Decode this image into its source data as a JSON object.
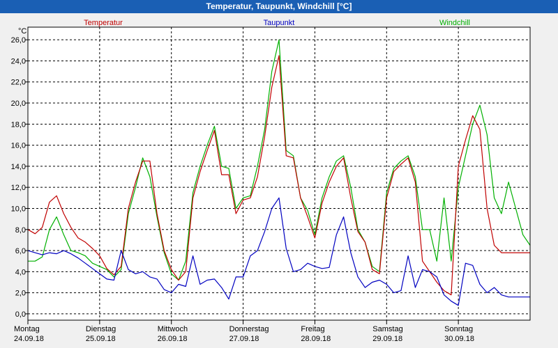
{
  "window": {
    "title": "Temperatur, Taupunkt, Windchill [°C]"
  },
  "chart_data": {
    "type": "line",
    "title": "Temperatur, Taupunkt, Windchill [°C]",
    "ylabel": "°C",
    "ylim": [
      -0.6,
      27.2
    ],
    "yticks": [
      0,
      2,
      4,
      6,
      8,
      10,
      12,
      14,
      16,
      18,
      20,
      22,
      24,
      26
    ],
    "ytick_labels": [
      "0,0",
      "2,0",
      "4,0",
      "6,0",
      "8,0",
      "10,0",
      "12,0",
      "14,0",
      "16,0",
      "18,0",
      "20,0",
      "22,0",
      "24,0",
      "26,0"
    ],
    "xlim": [
      0,
      7
    ],
    "grid": true,
    "legend_position": "top",
    "x_labels": [
      {
        "day": "Montag",
        "date": "24.09.18"
      },
      {
        "day": "Dienstag",
        "date": "25.09.18"
      },
      {
        "day": "Mittwoch",
        "date": "26.09.18"
      },
      {
        "day": "Donnerstag",
        "date": "27.09.18"
      },
      {
        "day": "Freitag",
        "date": "28.09.18"
      },
      {
        "day": "Samstag",
        "date": "29.09.18"
      },
      {
        "day": "Sonntag",
        "date": "30.09.18"
      }
    ],
    "series": [
      {
        "name": "Temperatur",
        "color": "#c00000",
        "x": [
          0,
          0.1,
          0.2,
          0.3,
          0.4,
          0.5,
          0.6,
          0.7,
          0.8,
          0.9,
          1.0,
          1.1,
          1.2,
          1.3,
          1.4,
          1.5,
          1.6,
          1.7,
          1.8,
          1.9,
          2.0,
          2.1,
          2.2,
          2.3,
          2.4,
          2.5,
          2.6,
          2.7,
          2.8,
          2.9,
          3.0,
          3.1,
          3.2,
          3.3,
          3.4,
          3.5,
          3.6,
          3.7,
          3.8,
          3.9,
          4.0,
          4.1,
          4.2,
          4.3,
          4.4,
          4.5,
          4.6,
          4.7,
          4.8,
          4.9,
          5.0,
          5.1,
          5.2,
          5.3,
          5.4,
          5.5,
          5.6,
          5.7,
          5.8,
          5.9,
          6.0,
          6.1,
          6.2,
          6.3,
          6.4,
          6.5,
          6.6,
          6.7,
          6.8,
          6.9,
          7.0
        ],
        "y": [
          8,
          7.6,
          8.2,
          10.6,
          11.2,
          9.5,
          8.2,
          7.2,
          6.8,
          6.2,
          5.5,
          4.3,
          3.7,
          4.5,
          10,
          12.5,
          14.5,
          14.5,
          9.5,
          6,
          4.2,
          3.2,
          4,
          11,
          13.5,
          15.5,
          17.4,
          13.2,
          13.2,
          9.5,
          10.8,
          11,
          13,
          16.8,
          21.5,
          24.5,
          15,
          14.8,
          11,
          9.2,
          7.2,
          10.5,
          12.5,
          14,
          14.8,
          11,
          7.8,
          6.8,
          4.2,
          3.8,
          11,
          13.5,
          14.2,
          14.8,
          12.5,
          5,
          4,
          3,
          2.2,
          1.8,
          14,
          16.5,
          18.8,
          17.5,
          10,
          6.5,
          5.8,
          5.8,
          5.8,
          5.8,
          5.8
        ]
      },
      {
        "name": "Taupunkt",
        "color": "#0000c0",
        "x": [
          0,
          0.1,
          0.2,
          0.3,
          0.4,
          0.5,
          0.6,
          0.7,
          0.8,
          0.9,
          1.0,
          1.1,
          1.2,
          1.3,
          1.4,
          1.5,
          1.6,
          1.7,
          1.8,
          1.9,
          2.0,
          2.1,
          2.2,
          2.3,
          2.4,
          2.5,
          2.6,
          2.7,
          2.8,
          2.9,
          3.0,
          3.1,
          3.2,
          3.3,
          3.4,
          3.5,
          3.6,
          3.7,
          3.8,
          3.9,
          4.0,
          4.1,
          4.2,
          4.3,
          4.4,
          4.5,
          4.6,
          4.7,
          4.8,
          4.9,
          5.0,
          5.1,
          5.2,
          5.3,
          5.4,
          5.5,
          5.6,
          5.7,
          5.8,
          5.9,
          6.0,
          6.1,
          6.2,
          6.3,
          6.4,
          6.5,
          6.6,
          6.7,
          6.8,
          6.9,
          7.0
        ],
        "y": [
          6,
          5.8,
          5.6,
          5.8,
          5.7,
          6,
          5.7,
          5.3,
          4.8,
          4.3,
          3.8,
          3.3,
          3.2,
          6,
          4.2,
          3.8,
          4,
          3.5,
          3.3,
          2.3,
          2,
          2.8,
          2.6,
          5.5,
          2.8,
          3.2,
          3.3,
          2.5,
          1.4,
          3.5,
          3.5,
          5.5,
          6,
          7.8,
          10,
          11,
          6.2,
          4,
          4.2,
          4.8,
          4.5,
          4.3,
          4.4,
          7.5,
          9.2,
          5.8,
          3.5,
          2.5,
          3,
          3.2,
          2.8,
          2,
          2.2,
          5.5,
          2.5,
          4.2,
          4,
          3.5,
          1.8,
          1.2,
          0.8,
          4.8,
          4.6,
          2.8,
          2,
          2.5,
          1.8,
          1.6,
          1.6,
          1.6,
          1.6
        ]
      },
      {
        "name": "Windchill",
        "color": "#00b000",
        "x": [
          0,
          0.1,
          0.2,
          0.3,
          0.4,
          0.5,
          0.6,
          0.7,
          0.8,
          0.9,
          1.0,
          1.1,
          1.2,
          1.3,
          1.4,
          1.5,
          1.6,
          1.7,
          1.8,
          1.9,
          2.0,
          2.1,
          2.2,
          2.3,
          2.4,
          2.5,
          2.6,
          2.7,
          2.8,
          2.9,
          3.0,
          3.1,
          3.2,
          3.3,
          3.4,
          3.5,
          3.6,
          3.7,
          3.8,
          3.9,
          4.0,
          4.1,
          4.2,
          4.3,
          4.4,
          4.5,
          4.6,
          4.7,
          4.8,
          4.9,
          5.0,
          5.1,
          5.2,
          5.3,
          5.4,
          5.5,
          5.6,
          5.7,
          5.8,
          5.9,
          6.0,
          6.1,
          6.2,
          6.3,
          6.4,
          6.5,
          6.6,
          6.7,
          6.8,
          6.9,
          7.0
        ],
        "y": [
          5,
          5,
          5.4,
          8,
          9.2,
          7.5,
          6,
          5.8,
          5.5,
          4.8,
          4.5,
          4.2,
          3.5,
          4.2,
          9.5,
          12,
          14.8,
          13,
          9.2,
          5.8,
          3.8,
          3.2,
          5,
          11.5,
          14,
          16,
          17.8,
          14,
          13.8,
          10,
          11,
          11.2,
          14,
          17.5,
          23,
          26,
          15.5,
          15,
          11,
          9.8,
          7.5,
          11,
          13,
          14.5,
          15,
          12,
          8,
          6.8,
          4.5,
          4,
          11.5,
          13.8,
          14.5,
          15,
          13,
          8,
          8,
          5,
          11,
          5,
          12,
          15,
          18,
          19.8,
          17,
          11,
          9.5,
          12.5,
          10,
          7.5,
          6.5
        ]
      }
    ]
  }
}
